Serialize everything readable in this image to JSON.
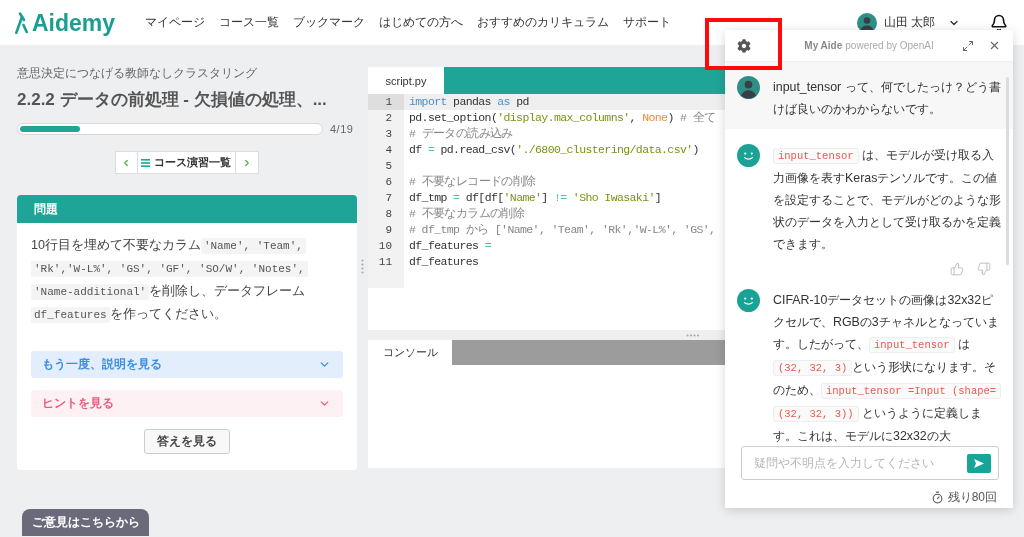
{
  "header": {
    "logo": "Aidemy",
    "nav": [
      {
        "label": "マイページ"
      },
      {
        "label": "コース一覧"
      },
      {
        "label": "ブックマーク"
      },
      {
        "label": "はじめての方へ"
      },
      {
        "label": "おすすめのカリキュラム"
      },
      {
        "label": "サポート"
      }
    ],
    "user": {
      "name": "山田 太郎"
    }
  },
  "lesson": {
    "course": "意思決定につなげる教師なしクラスタリング",
    "title": "2.2.2 データの前処理 - 欠損値の処理、...",
    "progress": {
      "level": 0.2,
      "reading": "4/19"
    },
    "pager": {
      "label": "コース演習一覧"
    }
  },
  "problem": {
    "heading": "問題",
    "body": [
      {
        "kind": "text",
        "text": "10行目を埋めて不要なカラム"
      },
      {
        "kind": "code",
        "text": "'Name', 'Team', 'Rk','W-L%', 'GS', 'GF', 'SO/W', 'Notes', 'Name-additional'"
      },
      {
        "kind": "text",
        "text": "を削除し、データフレーム"
      },
      {
        "kind": "code",
        "text": "df_features"
      },
      {
        "kind": "text",
        "text": "を作ってください。"
      }
    ],
    "accordions": [
      {
        "kind": "explanation",
        "label": "もう一度、説明を見る",
        "expanded": false
      },
      {
        "kind": "hint",
        "label": "ヒントを見る",
        "expanded": false
      }
    ],
    "answer_button": "答えを見る"
  },
  "feedback_button": "ご意見はこちらから",
  "editor": {
    "tabs": [
      {
        "label": "script.py",
        "selected": true
      }
    ],
    "lines": [
      {
        "number": "1",
        "active": true,
        "tokens": [
          {
            "kind": "keyword",
            "text": "import"
          },
          {
            "kind": "plain",
            "text": " pandas "
          },
          {
            "kind": "keyword",
            "text": "as"
          },
          {
            "kind": "plain",
            "text": " pd"
          }
        ]
      },
      {
        "number": "2",
        "active": false,
        "tokens": [
          {
            "kind": "plain",
            "text": "pd.set_option("
          },
          {
            "kind": "string",
            "text": "'display.max_columns'"
          },
          {
            "kind": "plain",
            "text": ", "
          },
          {
            "kind": "constant",
            "text": "None"
          },
          {
            "kind": "plain",
            "text": ") "
          },
          {
            "kind": "comment",
            "text": "# 全て"
          }
        ]
      },
      {
        "number": "3",
        "active": false,
        "tokens": [
          {
            "kind": "comment",
            "text": "# データの読み込み"
          }
        ]
      },
      {
        "number": "4",
        "active": false,
        "tokens": [
          {
            "kind": "plain",
            "text": "df "
          },
          {
            "kind": "operator",
            "text": "="
          },
          {
            "kind": "plain",
            "text": " pd.read_csv("
          },
          {
            "kind": "string",
            "text": "'./6800_clustering/data.csv'"
          },
          {
            "kind": "plain",
            "text": ")"
          }
        ]
      },
      {
        "number": "5",
        "active": false
      },
      {
        "number": "6",
        "active": false,
        "tokens": [
          {
            "kind": "comment",
            "text": "# 不要なレコードの削除"
          }
        ]
      },
      {
        "number": "7",
        "active": false,
        "tokens": [
          {
            "kind": "plain",
            "text": "df_tmp "
          },
          {
            "kind": "operator",
            "text": "="
          },
          {
            "kind": "plain",
            "text": " df[df["
          },
          {
            "kind": "string",
            "text": "'Name'"
          },
          {
            "kind": "plain",
            "text": "] "
          },
          {
            "kind": "operator",
            "text": "!="
          },
          {
            "kind": "string",
            "text": " 'Sho Iwasaki'"
          },
          {
            "kind": "plain",
            "text": "]"
          }
        ]
      },
      {
        "number": "8",
        "active": false,
        "tokens": [
          {
            "kind": "comment",
            "text": "# 不要なカラムの削除"
          }
        ]
      },
      {
        "number": "9",
        "active": false,
        "tokens": [
          {
            "kind": "comment",
            "text": "# df_tmp から ['Name', 'Team', 'Rk','W-L%', 'GS',"
          }
        ]
      },
      {
        "number": "10",
        "active": false,
        "tokens": [
          {
            "kind": "plain",
            "text": "df_features "
          },
          {
            "kind": "operator",
            "text": "="
          }
        ]
      },
      {
        "number": "11",
        "active": false,
        "tokens": [
          {
            "kind": "plain",
            "text": "df_features"
          }
        ]
      }
    ],
    "console_tabs": [
      {
        "label": "コンソール",
        "selected": true
      }
    ]
  },
  "aide": {
    "title": "My Aide",
    "subtitle": "powered by OpenAI",
    "messages": [
      {
        "kind": "user",
        "feedback": false,
        "segments": [
          {
            "kind": "text",
            "text": "input_tensor って、何でしたっけ？どう書けば良いのかわからないです。"
          }
        ]
      },
      {
        "kind": "assistant",
        "feedback": true,
        "segments": [
          {
            "kind": "code",
            "text": "input_tensor"
          },
          {
            "kind": "text",
            "text": " は、モデルが受け取る入力画像を表すKerasテンソルです。この値を設定することで、モデルがどのような形状のデータを入力として受け取るかを定義できます。"
          }
        ]
      },
      {
        "kind": "assistant",
        "feedback": false,
        "segments": [
          {
            "kind": "text",
            "text": "CIFAR-10データセットの画像は32x32ピクセルで、RGBの3チャネルとなっています。したがって、"
          },
          {
            "kind": "code",
            "text": "input_tensor"
          },
          {
            "kind": "text",
            "text": " は "
          },
          {
            "kind": "code",
            "text": "(32, 32, 3)"
          },
          {
            "kind": "text",
            "text": "という形状になります。そのため、"
          },
          {
            "kind": "code",
            "text": "input_tensor =Input (shape=(32, 32, 3))"
          },
          {
            "kind": "text",
            "text": " というように定義します。これは、モデルに32x32の大"
          }
        ]
      }
    ],
    "input": {
      "placeholder": "疑問や不明点を入力してください"
    },
    "remaining": "残り80回"
  }
}
